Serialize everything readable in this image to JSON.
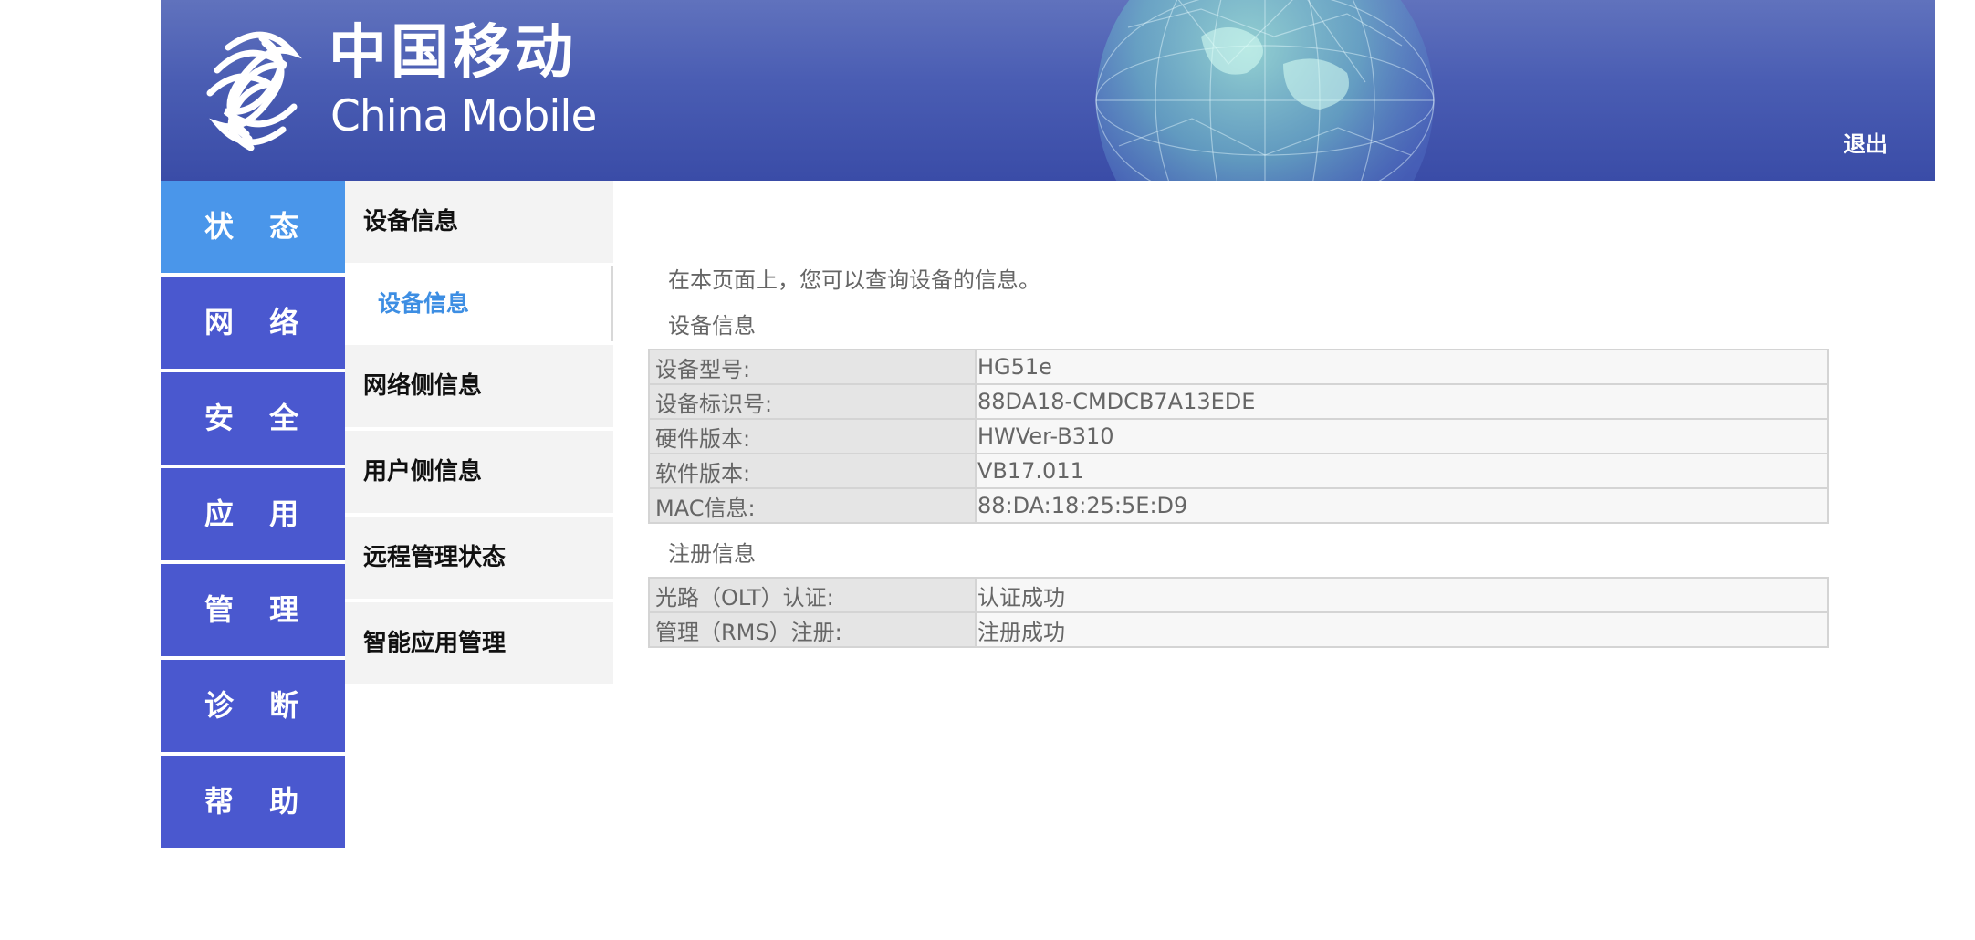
{
  "header": {
    "logo_cn": "中国移动",
    "logo_en": "China Mobile",
    "logout_label": "退出"
  },
  "main_nav": {
    "items": [
      {
        "label": "状 态",
        "active": true
      },
      {
        "label": "网 络"
      },
      {
        "label": "安 全"
      },
      {
        "label": "应 用"
      },
      {
        "label": "管 理"
      },
      {
        "label": "诊 断"
      },
      {
        "label": "帮 助"
      }
    ]
  },
  "sub_nav": {
    "items": [
      {
        "label": "设备信息"
      },
      {
        "label": "网络侧信息"
      },
      {
        "label": "用户侧信息"
      },
      {
        "label": "远程管理状态"
      },
      {
        "label": "智能应用管理"
      }
    ],
    "active_child": "设备信息"
  },
  "content": {
    "intro": "在本页面上，您可以查询设备的信息。",
    "device_section": {
      "title": "设备信息",
      "rows": [
        {
          "label": "设备型号:",
          "value": "HG51e"
        },
        {
          "label": "设备标识号:",
          "value": "88DA18-CMDCB7A13EDE"
        },
        {
          "label": "硬件版本:",
          "value": "HWVer-B310"
        },
        {
          "label": "软件版本:",
          "value": "VB17.011"
        },
        {
          "label": "MAC信息:",
          "value": "88:DA:18:25:5E:D9"
        }
      ]
    },
    "register_section": {
      "title": "注册信息",
      "rows": [
        {
          "label": "光路（OLT）认证:",
          "value": "认证成功"
        },
        {
          "label": "管理（RMS）注册:",
          "value": "注册成功"
        }
      ]
    }
  },
  "colors": {
    "header_top": "#6072bd",
    "header_bottom": "#3a4ca7",
    "nav_active": "#4a96ea",
    "nav_default": "#4a58cf",
    "sub_active_text": "#3d8ee3"
  }
}
